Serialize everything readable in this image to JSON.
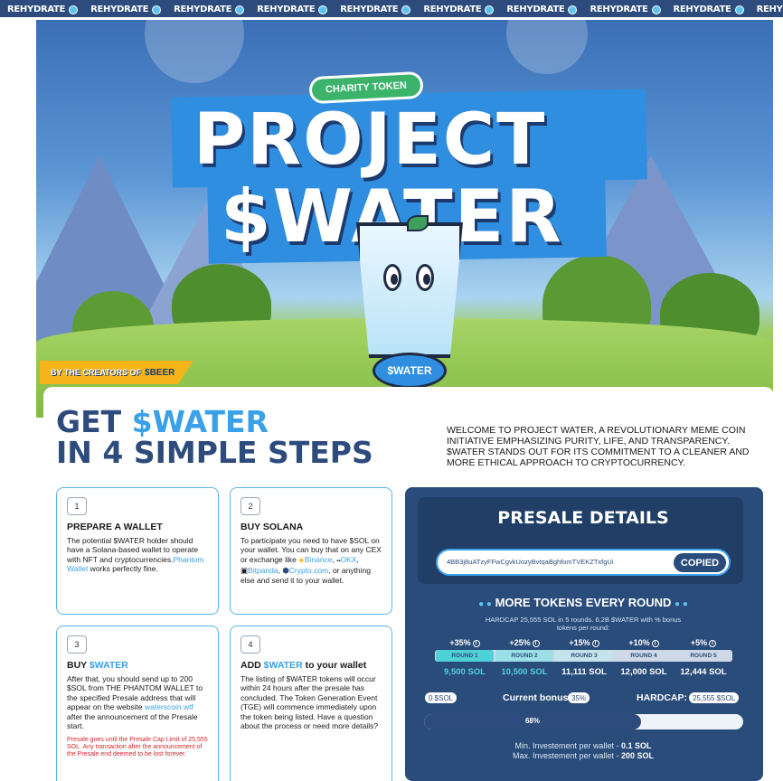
{
  "ticker": {
    "label": "REHYDRATE",
    "repeat": 12
  },
  "hero": {
    "badge": "CHARITY TOKEN",
    "title_line1": "PROJECT",
    "title_line2": "$WATER",
    "creators_prefix": "BY THE CREATORS OF",
    "creators_brand": "$BEER",
    "mascot_label": "$WATER"
  },
  "heading": {
    "get": "GET",
    "token": "$WATER",
    "line2": "IN 4 SIMPLE STEPS"
  },
  "intro": "WELCOME TO PROJECT WATER, A REVOLUTIONARY MEME COIN INITIATIVE EMPHASIZING PURITY, LIFE, AND TRANSPARENCY. $WATER STANDS OUT FOR ITS COMMITMENT TO A CLEANER AND MORE ETHICAL APPROACH TO CRYPTOCURRENCY.",
  "steps": [
    {
      "num": "1",
      "title": "PREPARE A WALLET",
      "text_a": "The potential $WATER holder should have a Solana-based wallet to operate with NFT and cryptocurrencies.",
      "link": "Phantom Wallet",
      "text_b": " works perfectly fine."
    },
    {
      "num": "2",
      "title": "BUY SOLANA",
      "text_a": "To participate you need to have $SOL on your wallet. You can buy that on any CEX or exchange like ",
      "ex1": "Binance",
      "ex2": "OKX",
      "ex3": "Bitpanda",
      "ex4": "Crypto.com",
      "text_b": ", or anything else and send it to your wallet."
    },
    {
      "num": "3",
      "title_a": "BUY ",
      "title_b": "$WATER",
      "text_a": "After that, you should send up to 200 $SOL from THE PHANTOM WALLET to the specified Presale address that will appear on the website ",
      "link": "waterscoin.wtf",
      "text_b": " after the announcement of the Presale start.",
      "warning": "Presale goes until the Presale Cap Limit of 25,555 SOL. Any transaction after the announcement of the Presale end deemed to be lost forever."
    },
    {
      "num": "4",
      "title_a": "ADD ",
      "title_b": "$WATER",
      "title_c": " to your wallet",
      "text": "The listing of $WATER tokens will occur within 24 hours after the presale has concluded. The Token Generation Event (TGE) will commence immediately upon the token being listed. Have a question about the process or need more details?"
    }
  ],
  "presale": {
    "title": "PRESALE DETAILS",
    "address": "4BB3j8uATzyFFwCgvkUozyBvtqaBghfomTVEKZTxfgUi",
    "copy_button": "COPIED",
    "more_title": "MORE TOKENS EVERY ROUND",
    "hardcap_note": "HARDCAP 25,555 SOL in 5 rounds. 6.2B $WATER with % bonus tokens per round:",
    "rounds": [
      {
        "bonus": "+35%",
        "label": "ROUND 1",
        "sol": "9,500 SOL"
      },
      {
        "bonus": "+25%",
        "label": "ROUND 2",
        "sol": "10,500 SOL"
      },
      {
        "bonus": "+15%",
        "label": "ROUND 3",
        "sol": "11,111 SOL"
      },
      {
        "bonus": "+10%",
        "label": "ROUND 4",
        "sol": "12,000 SOL"
      },
      {
        "bonus": "+5%",
        "label": "ROUND 5",
        "sol": "12,444 SOL"
      }
    ],
    "raised": "0 $SOL",
    "current_bonus_label": "Current bonus:",
    "current_bonus": "35%",
    "hardcap_label": "HARDCAP:",
    "hardcap": "25,555 $SOL",
    "progress_label": "68%",
    "progress_value": 0.68,
    "min_label": "Min. Investement per wallet - ",
    "min_value": "0.1 SOL",
    "max_label": "Max. Investement per wallet - ",
    "max_value": "200 SOL"
  },
  "colors": {
    "navy": "#2d4b7c",
    "accent": "#3aa0e8",
    "panel": "#2a4c7a",
    "warning": "#d8262a"
  }
}
